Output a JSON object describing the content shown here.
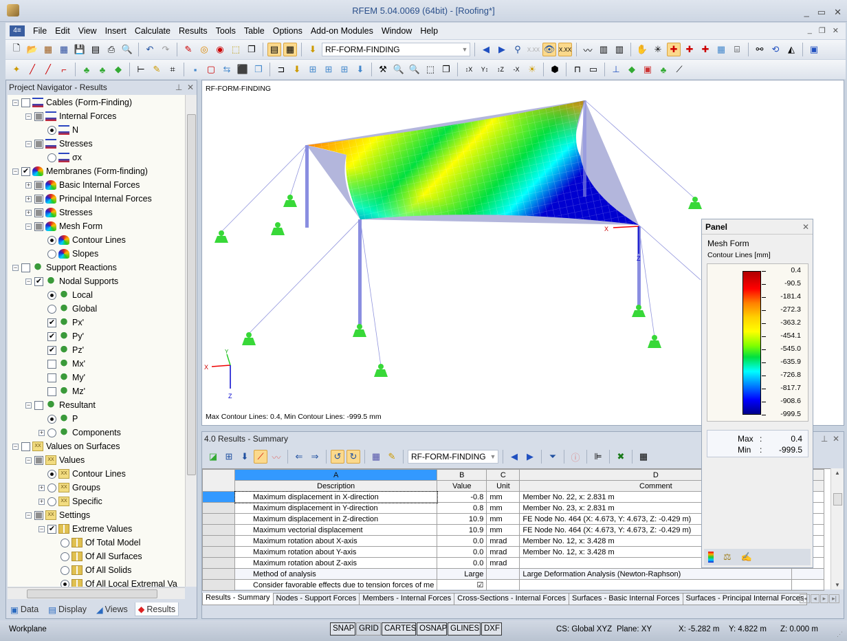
{
  "window": {
    "title": "RFEM 5.04.0069 (64bit) - [Roofing*]"
  },
  "menu": [
    "File",
    "Edit",
    "View",
    "Insert",
    "Calculate",
    "Results",
    "Tools",
    "Table",
    "Options",
    "Add-on Modules",
    "Window",
    "Help"
  ],
  "toolbar": {
    "load_case_combo": "RF-FORM-FINDING"
  },
  "navigator": {
    "title": "Project Navigator - Results",
    "items": [
      {
        "label": "Cables (Form-Finding)",
        "level": 0,
        "exp": "-",
        "ctl": "cb",
        "state": "none",
        "icon": "cable"
      },
      {
        "label": "Internal Forces",
        "level": 1,
        "exp": "-",
        "ctl": "cb",
        "state": "partial",
        "icon": "cable"
      },
      {
        "label": "N",
        "level": 2,
        "exp": "",
        "ctl": "rb",
        "state": "on",
        "icon": "cable"
      },
      {
        "label": "Stresses",
        "level": 1,
        "exp": "-",
        "ctl": "cb",
        "state": "partial",
        "icon": "cable"
      },
      {
        "label": "σx",
        "level": 2,
        "exp": "",
        "ctl": "rb",
        "state": "off",
        "icon": "cable"
      },
      {
        "label": "Membranes (Form-finding)",
        "level": 0,
        "exp": "-",
        "ctl": "cb",
        "state": "check",
        "icon": "memb"
      },
      {
        "label": "Basic Internal Forces",
        "level": 1,
        "exp": "+",
        "ctl": "cb",
        "state": "partial",
        "icon": "memb"
      },
      {
        "label": "Principal Internal Forces",
        "level": 1,
        "exp": "+",
        "ctl": "cb",
        "state": "partial",
        "icon": "memb"
      },
      {
        "label": "Stresses",
        "level": 1,
        "exp": "+",
        "ctl": "cb",
        "state": "partial",
        "icon": "memb"
      },
      {
        "label": "Mesh Form",
        "level": 1,
        "exp": "-",
        "ctl": "cb",
        "state": "partial",
        "icon": "memb"
      },
      {
        "label": "Contour Lines",
        "level": 2,
        "exp": "",
        "ctl": "rb",
        "state": "on",
        "icon": "memb"
      },
      {
        "label": "Slopes",
        "level": 2,
        "exp": "",
        "ctl": "rb",
        "state": "off",
        "icon": "memb"
      },
      {
        "label": "Support Reactions",
        "level": 0,
        "exp": "-",
        "ctl": "cb",
        "state": "none",
        "icon": "supp"
      },
      {
        "label": "Nodal Supports",
        "level": 1,
        "exp": "-",
        "ctl": "cb",
        "state": "check",
        "icon": "supp"
      },
      {
        "label": "Local",
        "level": 2,
        "exp": "",
        "ctl": "rb",
        "state": "on",
        "icon": "supp"
      },
      {
        "label": "Global",
        "level": 2,
        "exp": "",
        "ctl": "rb",
        "state": "off",
        "icon": "supp"
      },
      {
        "label": "Px'",
        "level": 2,
        "exp": "",
        "ctl": "cb",
        "state": "check",
        "icon": "supp"
      },
      {
        "label": "Py'",
        "level": 2,
        "exp": "",
        "ctl": "cb",
        "state": "check",
        "icon": "supp"
      },
      {
        "label": "Pz'",
        "level": 2,
        "exp": "",
        "ctl": "cb",
        "state": "check",
        "icon": "supp"
      },
      {
        "label": "Mx'",
        "level": 2,
        "exp": "",
        "ctl": "cb",
        "state": "none",
        "icon": "supp"
      },
      {
        "label": "My'",
        "level": 2,
        "exp": "",
        "ctl": "cb",
        "state": "none",
        "icon": "supp"
      },
      {
        "label": "Mz'",
        "level": 2,
        "exp": "",
        "ctl": "cb",
        "state": "none",
        "icon": "supp"
      },
      {
        "label": "Resultant",
        "level": 1,
        "exp": "-",
        "ctl": "cb",
        "state": "none",
        "icon": "supp"
      },
      {
        "label": "P",
        "level": 2,
        "exp": "",
        "ctl": "rb",
        "state": "on",
        "icon": "supp"
      },
      {
        "label": "Components",
        "level": 2,
        "exp": "+",
        "ctl": "rb",
        "state": "off",
        "icon": "supp"
      },
      {
        "label": "Values on Surfaces",
        "level": 0,
        "exp": "-",
        "ctl": "cb",
        "state": "none",
        "icon": "xx"
      },
      {
        "label": "Values",
        "level": 1,
        "exp": "-",
        "ctl": "cb",
        "state": "partial",
        "icon": "xx"
      },
      {
        "label": "Contour Lines",
        "level": 2,
        "exp": "",
        "ctl": "rb",
        "state": "on",
        "icon": "xx"
      },
      {
        "label": "Groups",
        "level": 2,
        "exp": "+",
        "ctl": "rb",
        "state": "off",
        "icon": "xx"
      },
      {
        "label": "Specific",
        "level": 2,
        "exp": "+",
        "ctl": "rb",
        "state": "off",
        "icon": "xx"
      },
      {
        "label": "Settings",
        "level": 1,
        "exp": "-",
        "ctl": "cb",
        "state": "partial",
        "icon": "xx"
      },
      {
        "label": "Extreme Values",
        "level": 2,
        "exp": "-",
        "ctl": "cb",
        "state": "check",
        "icon": "ext"
      },
      {
        "label": "Of Total Model",
        "level": 3,
        "exp": "",
        "ctl": "rb",
        "state": "off",
        "icon": "ext"
      },
      {
        "label": "Of All Surfaces",
        "level": 3,
        "exp": "",
        "ctl": "rb",
        "state": "off",
        "icon": "ext"
      },
      {
        "label": "Of All Solids",
        "level": 3,
        "exp": "",
        "ctl": "rb",
        "state": "off",
        "icon": "ext"
      },
      {
        "label": "Of All Local Extremal Va",
        "level": 3,
        "exp": "",
        "ctl": "rb",
        "state": "on",
        "icon": "ext"
      }
    ],
    "tabs": [
      {
        "label": "Data",
        "active": false
      },
      {
        "label": "Display",
        "active": false
      },
      {
        "label": "Views",
        "active": false
      },
      {
        "label": "Results",
        "active": true
      }
    ]
  },
  "viewport": {
    "title": "RF-FORM-FINDING",
    "footer": "Max Contour Lines: 0.4, Min Contour Lines: -999.5 mm",
    "axis_labels": {
      "x": "X",
      "y": "Y",
      "z": "Z"
    }
  },
  "panel": {
    "title": "Panel",
    "heading": "Mesh Form",
    "subheading": "Contour Lines [mm]",
    "scale": [
      "0.4",
      "-90.5",
      "-181.4",
      "-272.3",
      "-363.2",
      "-454.1",
      "-545.0",
      "-635.9",
      "-726.8",
      "-817.7",
      "-908.6",
      "-999.5"
    ],
    "max_label": "Max",
    "max_value": "0.4",
    "min_label": "Min",
    "min_value": "-999.5"
  },
  "results": {
    "title": "4.0 Results - Summary",
    "combo": "RF-FORM-FINDING",
    "columns": [
      {
        "letter": "A",
        "name": "Description"
      },
      {
        "letter": "B",
        "name": "Value"
      },
      {
        "letter": "C",
        "name": "Unit"
      },
      {
        "letter": "D",
        "name": "Comment"
      }
    ],
    "rows": [
      {
        "desc": "Maximum displacement in X-direction",
        "value": "-0.8",
        "unit": "mm",
        "comment": "Member No. 22,  x: 2.831 m"
      },
      {
        "desc": "Maximum displacement in Y-direction",
        "value": "0.8",
        "unit": "mm",
        "comment": "Member No. 23,  x: 2.831 m"
      },
      {
        "desc": "Maximum displacement in Z-direction",
        "value": "10.9",
        "unit": "mm",
        "comment": "FE Node No. 464  (X: 4.673,  Y: 4.673,  Z: -0.429 m)"
      },
      {
        "desc": "Maximum vectorial displacement",
        "value": "10.9",
        "unit": "mm",
        "comment": "FE Node No. 464  (X: 4.673,  Y: 4.673,  Z: -0.429 m)"
      },
      {
        "desc": "Maximum rotation about X-axis",
        "value": "0.0",
        "unit": "mrad",
        "comment": "Member No. 12,  x: 3.428 m"
      },
      {
        "desc": "Maximum rotation about Y-axis",
        "value": "0.0",
        "unit": "mrad",
        "comment": "Member No. 12,  x: 3.428 m"
      },
      {
        "desc": "Maximum rotation about Z-axis",
        "value": "0.0",
        "unit": "mrad",
        "comment": ""
      },
      {
        "desc": "Method of analysis",
        "value": "Large",
        "unit": "",
        "comment": "Large Deformation Analysis (Newton-Raphson)"
      },
      {
        "desc": "Consider favorable effects due to tension forces of me",
        "value": "☑",
        "unit": "",
        "comment": ""
      }
    ],
    "tabs": [
      "Results - Summary",
      "Nodes - Support Forces",
      "Members - Internal Forces",
      "Cross-Sections - Internal Forces",
      "Surfaces - Basic Internal Forces",
      "Surfaces - Principal Internal Forces"
    ]
  },
  "statusbar": {
    "workplane": "Workplane",
    "toggles": [
      {
        "label": "SNAP",
        "on": true
      },
      {
        "label": "GRID",
        "on": false
      },
      {
        "label": "CARTES",
        "on": true
      },
      {
        "label": "OSNAP",
        "on": true
      },
      {
        "label": "GLINES",
        "on": true
      },
      {
        "label": "DXF",
        "on": true
      }
    ],
    "cs": "CS: Global XYZ",
    "plane": "Plane: XY",
    "x": "X: -5.282 m",
    "y": "Y: 4.822 m",
    "z": "Z: 0.000 m"
  }
}
